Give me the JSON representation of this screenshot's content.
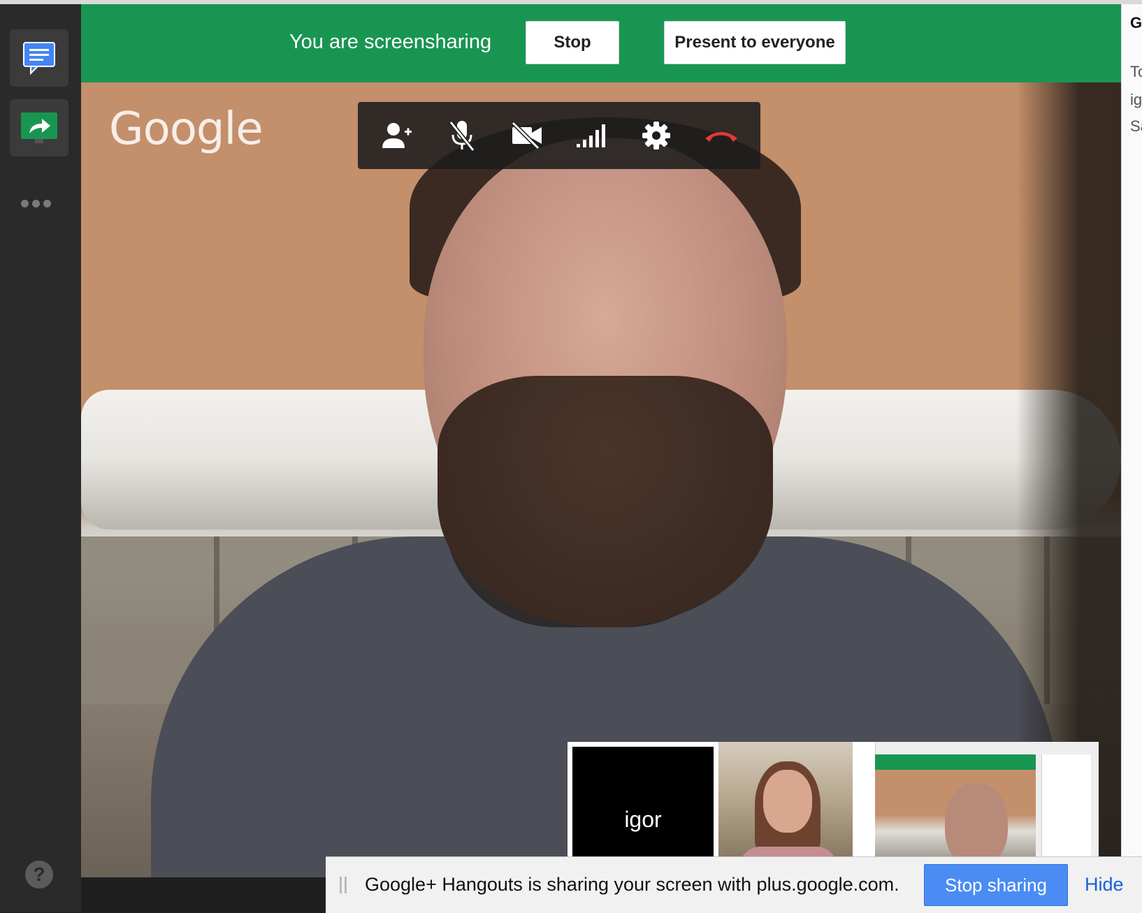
{
  "share_bar": {
    "message": "You are screensharing",
    "stop_label": "Stop",
    "present_label": "Present to everyone"
  },
  "video": {
    "watermark": "Google"
  },
  "toolbar": {
    "icons": [
      "add-person-icon",
      "mic-muted-icon",
      "camera-off-icon",
      "signal-bars-icon",
      "settings-icon",
      "hang-up-icon"
    ]
  },
  "filmstrip": {
    "self_name": "igor"
  },
  "right_panel": {
    "lines": [
      "G",
      "To",
      "ig",
      "Sa"
    ]
  },
  "notification": {
    "message": "Google+ Hangouts is sharing your screen with plus.google.com.",
    "stop_label": "Stop sharing",
    "hide_label": "Hide"
  },
  "left_rail": {
    "help_label": "?"
  },
  "colors": {
    "share_bar": "#199552",
    "hang_up": "#e53935",
    "stop_sharing_button": "#4a8cf3"
  }
}
